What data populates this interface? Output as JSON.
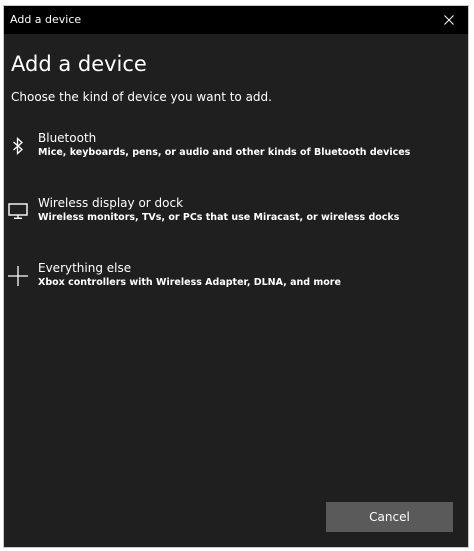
{
  "window": {
    "title": "Add a device",
    "close_icon": "close-icon"
  },
  "main": {
    "heading": "Add a device",
    "subheading": "Choose the kind of device you want to add.",
    "options": [
      {
        "icon": "bluetooth-icon",
        "label": "Bluetooth",
        "description": "Mice, keyboards, pens, or audio and other kinds of Bluetooth devices"
      },
      {
        "icon": "monitor-icon",
        "label": "Wireless display or dock",
        "description": "Wireless monitors, TVs, or PCs that use Miracast, or wireless docks"
      },
      {
        "icon": "plus-icon",
        "label": "Everything else",
        "description": "Xbox controllers with Wireless Adapter, DLNA, and more"
      }
    ]
  },
  "footer": {
    "cancel_label": "Cancel"
  },
  "colors": {
    "window_background": "#1f1f1f",
    "titlebar_background": "#000000",
    "text": "#ffffff",
    "button_background": "#5a5a5a"
  }
}
